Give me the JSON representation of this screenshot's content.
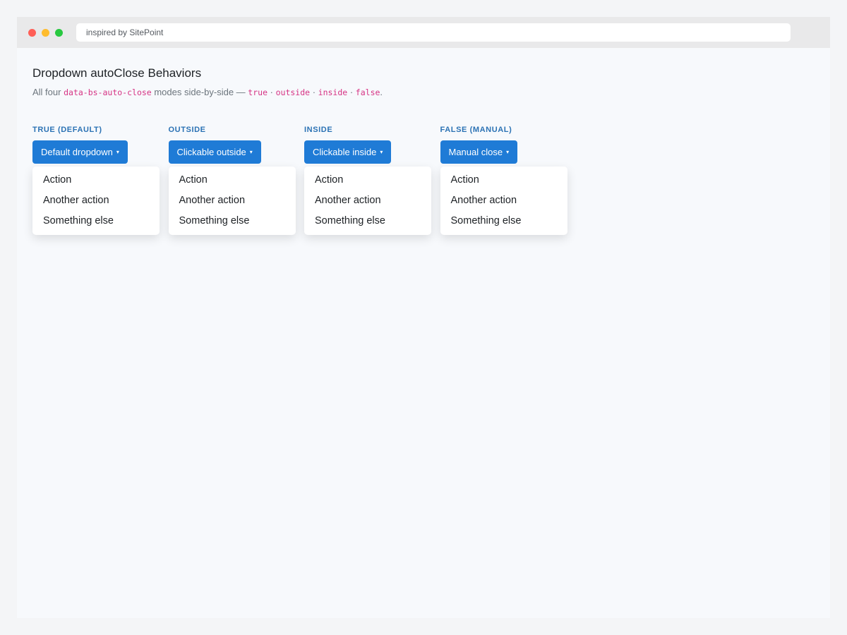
{
  "browser": {
    "address": "inspired by SitePoint"
  },
  "page": {
    "title": "Dropdown autoClose Behaviors",
    "subtitle": {
      "prefix": "All four",
      "attr": "data-bs-auto-close",
      "middle": "modes side-by-side —",
      "modes": [
        "true",
        "outside",
        "inside",
        "false"
      ],
      "separator": "·",
      "suffix": "."
    }
  },
  "groups": [
    {
      "label": "TRUE (DEFAULT)",
      "button": "Default dropdown",
      "items": [
        "Action",
        "Another action",
        "Something else"
      ]
    },
    {
      "label": "OUTSIDE",
      "button": "Clickable outside",
      "items": [
        "Action",
        "Another action",
        "Something else"
      ]
    },
    {
      "label": "INSIDE",
      "button": "Clickable inside",
      "items": [
        "Action",
        "Another action",
        "Something else"
      ]
    },
    {
      "label": "FALSE (MANUAL)",
      "button": "Manual close",
      "items": [
        "Action",
        "Another action",
        "Something else"
      ]
    }
  ],
  "caret": "▾",
  "colors": {
    "accent": "#1f7bd6",
    "label": "#2b72b4",
    "code": "#d63384",
    "window_close": "#ff5f57",
    "window_minimize": "#febc2e",
    "window_maximize": "#28c840"
  }
}
